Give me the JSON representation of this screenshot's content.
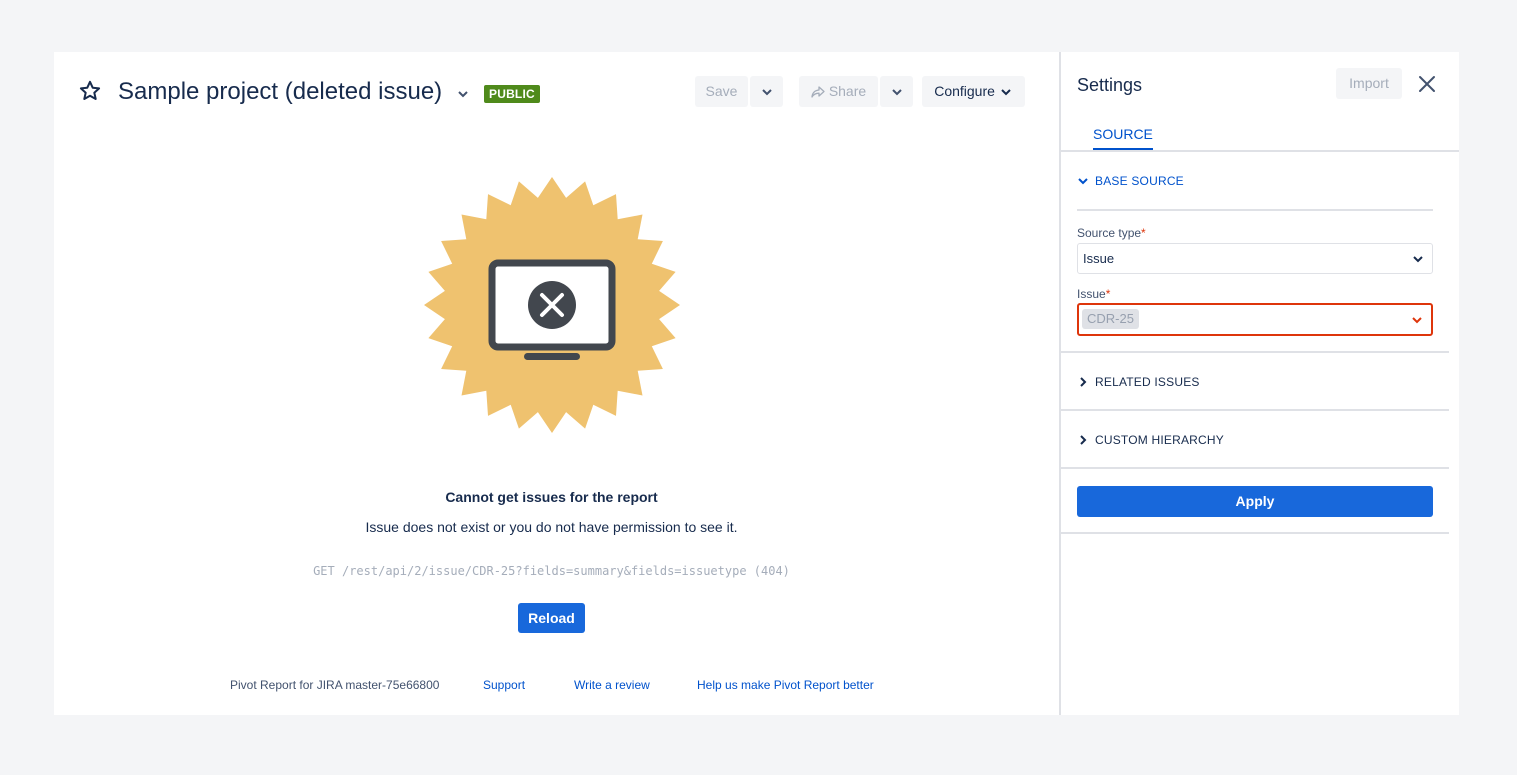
{
  "header": {
    "title": "Sample project (deleted issue)",
    "badge": "PUBLIC",
    "save_label": "Save",
    "share_label": "Share",
    "configure_label": "Configure"
  },
  "error": {
    "title": "Cannot get issues for the report",
    "message": "Issue does not exist or you do not have permission to see it.",
    "request": "GET /rest/api/2/issue/CDR-25?fields=summary&fields=issuetype (404)",
    "reload_label": "Reload"
  },
  "footer": {
    "version": "Pivot Report for JIRA master-75e66800",
    "support": "Support",
    "review": "Write a review",
    "help": "Help us make Pivot Report better"
  },
  "settings": {
    "title": "Settings",
    "import_label": "Import",
    "tab_source": "SOURCE",
    "base_source": "BASE SOURCE",
    "source_type_label": "Source type",
    "source_type_value": "Issue",
    "issue_label": "Issue",
    "issue_value": "CDR-25",
    "required_mark": "*",
    "related_issues": "RELATED ISSUES",
    "custom_hierarchy": "CUSTOM HIERARCHY",
    "apply_label": "Apply"
  },
  "colors": {
    "accent": "#1868db",
    "badge": "#4f8a1b",
    "error_border": "#de350b",
    "illustration": "#efc26f"
  },
  "icons": [
    "star-icon",
    "chevron-down-icon",
    "share-icon",
    "monitor-error-icon",
    "close-icon",
    "chevron-right-icon"
  ]
}
